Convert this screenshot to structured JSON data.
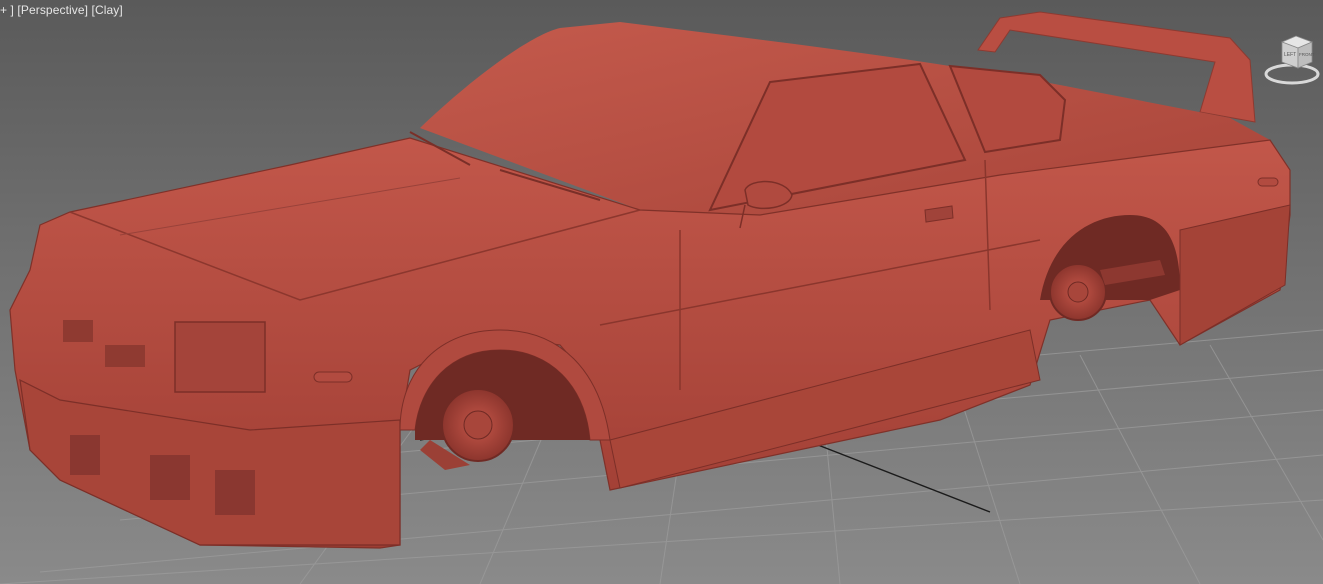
{
  "viewport": {
    "menu_plus": "+",
    "view_label": "Perspective",
    "shading_label": "Clay"
  },
  "viewcube": {
    "face_left": "LEFT",
    "face_front": "FRONT"
  },
  "colors": {
    "clay": "#b0483d",
    "background_top": "#5a5a5a",
    "background_bottom": "#8a8a8a",
    "grid": "#9a9a9a"
  }
}
